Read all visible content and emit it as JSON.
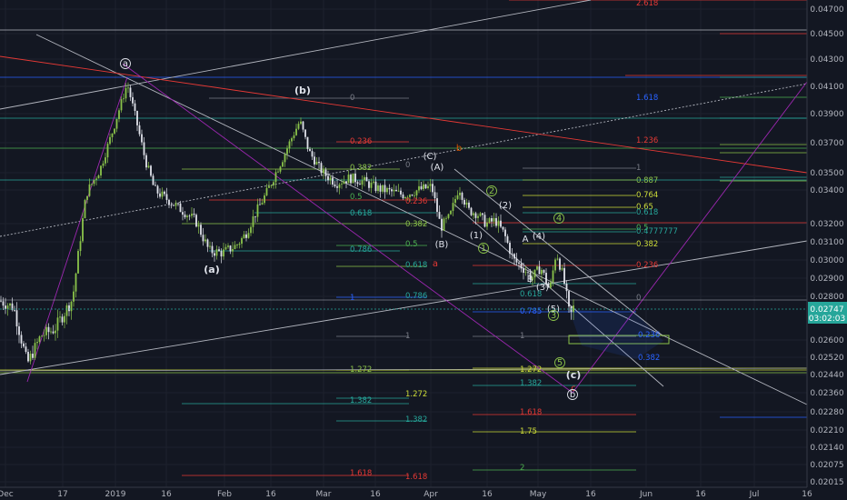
{
  "chart_data": {
    "type": "candlestick",
    "y_axis": {
      "ticks": [
        "0.04700",
        "0.04500",
        "0.04300",
        "0.04100",
        "0.03900",
        "0.03700",
        "0.03500",
        "0.03400",
        "0.03200",
        "0.03100",
        "0.03000",
        "0.02900",
        "0.02800",
        "0.02600",
        "0.02520",
        "0.02440",
        "0.02360",
        "0.02280",
        "0.02210",
        "0.02140",
        "0.02075",
        "0.02015"
      ],
      "tick_values": [
        0.047,
        0.045,
        0.043,
        0.041,
        0.039,
        0.037,
        0.035,
        0.034,
        0.032,
        0.031,
        0.03,
        0.029,
        0.028,
        0.026,
        0.0252,
        0.0244,
        0.0236,
        0.0228,
        0.0221,
        0.0214,
        0.02075,
        0.02015
      ],
      "current_price": "0.02747",
      "countdown": "03:02:03"
    },
    "x_axis": {
      "ticks": [
        "Dec",
        "17",
        "2019",
        "16",
        "Feb",
        "16",
        "Mar",
        "16",
        "Apr",
        "16",
        "May",
        "16",
        "Jun",
        "16",
        "Jul",
        "16"
      ]
    },
    "wave_labels": [
      {
        "text": "a",
        "circled": true
      },
      {
        "text": "(b)",
        "circled": false
      },
      {
        "text": "(a)",
        "circled": false
      },
      {
        "text": "b",
        "circled": false,
        "color": "#d35400"
      },
      {
        "text": "(C)",
        "circled": false
      },
      {
        "text": "(A)",
        "circled": false
      },
      {
        "text": "(B)",
        "circled": false
      },
      {
        "text": "a",
        "circled": false,
        "color": "#e53935"
      },
      {
        "text": "1",
        "circled": true
      },
      {
        "text": "2",
        "circled": true
      },
      {
        "text": "(1)",
        "circled": false
      },
      {
        "text": "(2)",
        "circled": false
      },
      {
        "text": "A",
        "circled": false
      },
      {
        "text": "B",
        "circled": false
      },
      {
        "text": "(3)",
        "circled": false
      },
      {
        "text": "(4)",
        "circled": false
      },
      {
        "text": "4",
        "circled": true
      },
      {
        "text": "(5)",
        "circled": false
      },
      {
        "text": "3",
        "circled": true
      },
      {
        "text": "5",
        "circled": true
      },
      {
        "text": "(c)",
        "circled": false
      },
      {
        "text": "c",
        "circled": false,
        "color": "#e53935"
      },
      {
        "text": "b",
        "circled": true
      }
    ],
    "fib_labels": [
      {
        "text": "2.618",
        "color": "#e53935"
      },
      {
        "text": "0",
        "color": "#787b86"
      },
      {
        "text": "0.236",
        "color": "#e53935"
      },
      {
        "text": "0.382",
        "color": "#8bc34a"
      },
      {
        "text": "0",
        "color": "#787b86"
      },
      {
        "text": "0.236",
        "color": "#e53935"
      },
      {
        "text": "0.5",
        "color": "#4caf50"
      },
      {
        "text": "0.618",
        "color": "#26a69a"
      },
      {
        "text": "0.382",
        "color": "#8bc34a"
      },
      {
        "text": "0.5",
        "color": "#4caf50"
      },
      {
        "text": "0.786",
        "color": "#26a69a"
      },
      {
        "text": "0.618",
        "color": "#26a69a"
      },
      {
        "text": "1",
        "color": "#2962ff"
      },
      {
        "text": "0.786",
        "color": "#26a69a"
      },
      {
        "text": "1",
        "color": "#787b86"
      },
      {
        "text": "1.272",
        "color": "#8bc34a"
      },
      {
        "text": "1.382",
        "color": "#26a69a"
      },
      {
        "text": "1.272",
        "color": "#cddc39"
      },
      {
        "text": "1.382",
        "color": "#26a69a"
      },
      {
        "text": "1.618",
        "color": "#e53935"
      },
      {
        "text": "1.618",
        "color": "#e53935"
      },
      {
        "text": "1",
        "color": "#787b86"
      },
      {
        "text": "0.887",
        "color": "#8bc34a"
      },
      {
        "text": "0.764",
        "color": "#cddc39"
      },
      {
        "text": "0.65",
        "color": "#cddc39"
      },
      {
        "text": "0.618",
        "color": "#26a69a"
      },
      {
        "text": "0.5",
        "color": "#4caf50"
      },
      {
        "text": "0.4777777",
        "color": "#26a69a"
      },
      {
        "text": "0.382",
        "color": "#cddc39"
      },
      {
        "text": "0.236",
        "color": "#e53935"
      },
      {
        "text": "0",
        "color": "#787b86"
      },
      {
        "text": "0.618",
        "color": "#26a69a"
      },
      {
        "text": "0.785",
        "color": "#2962ff"
      },
      {
        "text": "1",
        "color": "#787b86"
      },
      {
        "text": "1.272",
        "color": "#cddc39"
      },
      {
        "text": "1.382",
        "color": "#26a69a"
      },
      {
        "text": "1.618",
        "color": "#e53935"
      },
      {
        "text": "1.75",
        "color": "#cddc39"
      },
      {
        "text": "2",
        "color": "#4caf50"
      },
      {
        "text": "1.618",
        "color": "#2962ff"
      },
      {
        "text": "1.236",
        "color": "#e53935"
      },
      {
        "text": "0.236",
        "color": "#2962ff"
      },
      {
        "text": "0.382",
        "color": "#2962ff"
      }
    ],
    "colors": {
      "background": "#131722",
      "price_tag": "#26a69a",
      "candle_up": "#8bc34a",
      "candle_down": "#ffffff",
      "red": "#e53935",
      "purple": "#9c27b0"
    }
  }
}
